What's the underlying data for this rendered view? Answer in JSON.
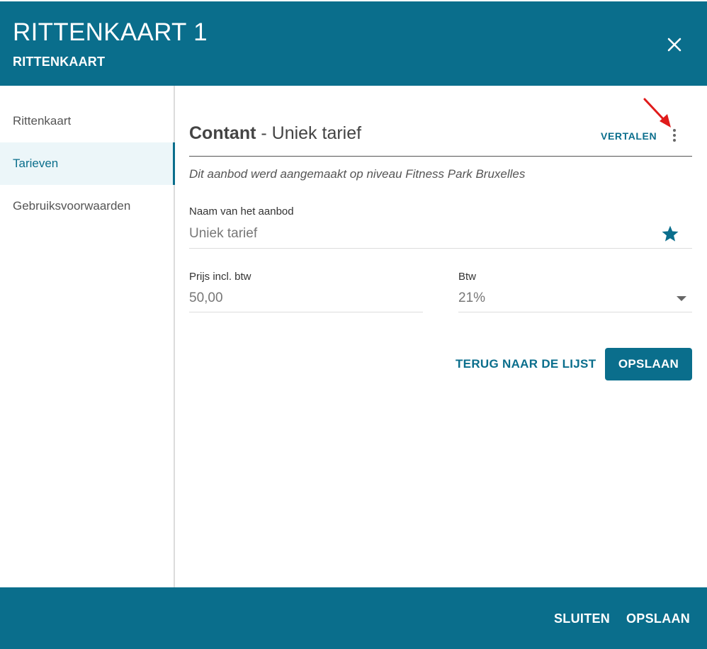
{
  "header": {
    "title": "RITTENKAART 1",
    "subtitle": "RITTENKAART",
    "close_icon": "close-icon"
  },
  "sidebar": {
    "items": [
      {
        "label": "Rittenkaart",
        "active": false
      },
      {
        "label": "Tarieven",
        "active": true
      },
      {
        "label": "Gebruiksvoorwaarden",
        "active": false
      }
    ]
  },
  "section": {
    "title_bold": "Contant",
    "title_rest": " - Uniek tarief",
    "translate_label": "VERTALEN",
    "more_icon": "more-vertical-icon",
    "note": "Dit aanbod werd aangemaakt op niveau Fitness Park Bruxelles"
  },
  "form": {
    "name_label": "Naam van het aanbod",
    "name_value": "Uniek tarief",
    "favorite_icon": "star-icon",
    "price_label": "Prijs incl. btw",
    "price_value": "50,00",
    "vat_label": "Btw",
    "vat_value": "21%"
  },
  "actions": {
    "back_label": "TERUG NAAR DE LIJST",
    "save_label": "OPSLAAN"
  },
  "footer": {
    "close_label": "SLUITEN",
    "save_label": "OPSLAAN"
  },
  "colors": {
    "primary": "#0a6e8c",
    "annotation_arrow": "#e01b1b"
  }
}
